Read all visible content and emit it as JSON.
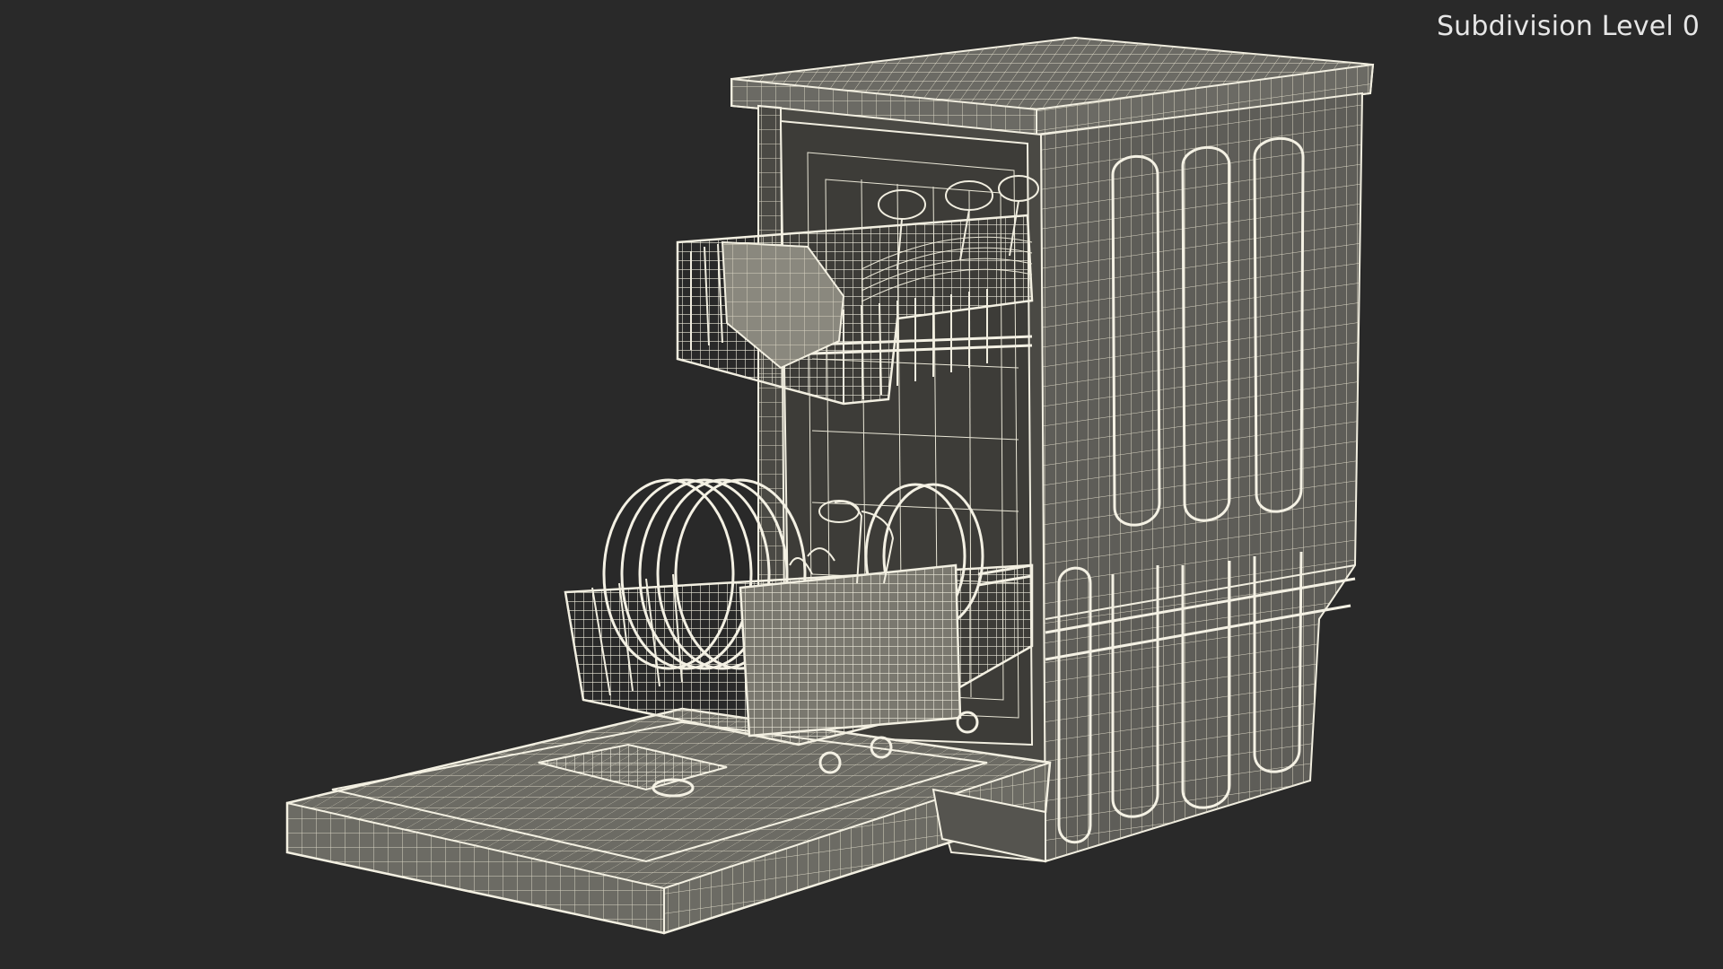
{
  "viewport": {
    "subdivision_label": "Subdivision Level 0",
    "background_color": "#292929",
    "wire_color": "#e9e6d6"
  },
  "model": {
    "subject": "dishwasher-wireframe"
  }
}
